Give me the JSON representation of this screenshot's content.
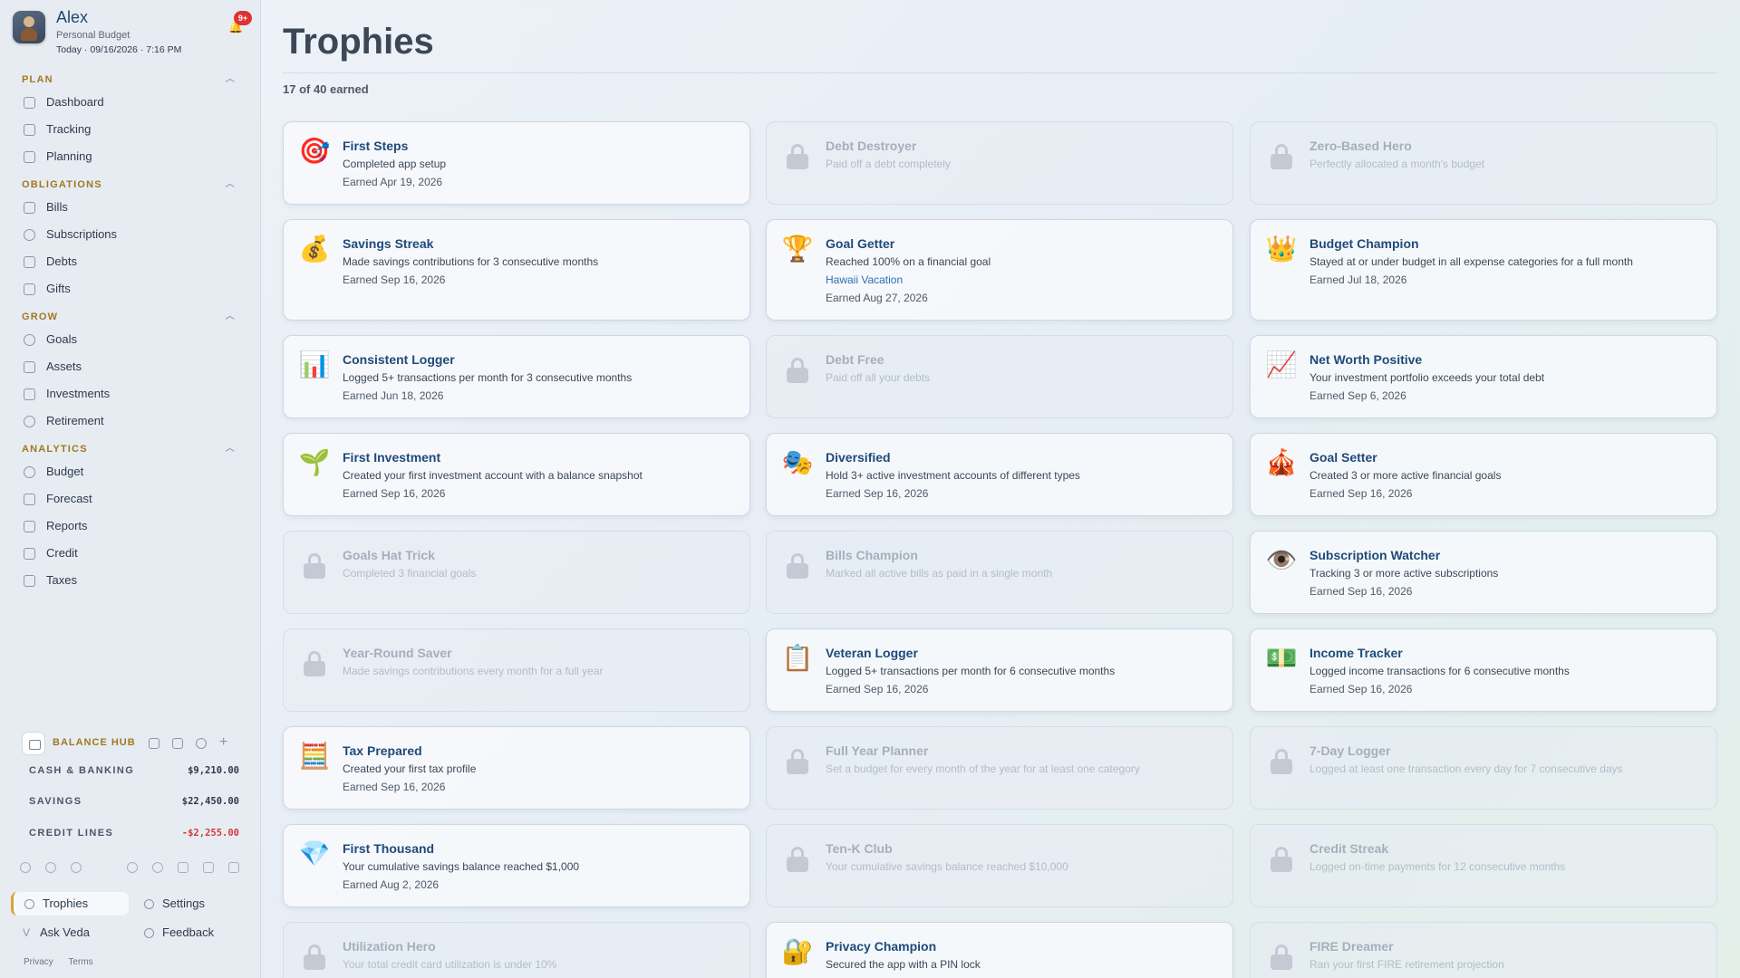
{
  "profile": {
    "name": "Alex",
    "subtitle": "Personal Budget",
    "date": "Today · 09/16/2026 · 7:16 PM",
    "notifications": "9+"
  },
  "sidebar": {
    "sections": [
      {
        "label": "PLAN",
        "items": [
          "Dashboard",
          "Tracking",
          "Planning"
        ]
      },
      {
        "label": "OBLIGATIONS",
        "items": [
          "Bills",
          "Subscriptions",
          "Debts",
          "Gifts"
        ]
      },
      {
        "label": "GROW",
        "items": [
          "Goals",
          "Assets",
          "Investments",
          "Retirement"
        ]
      },
      {
        "label": "ANALYTICS",
        "items": [
          "Budget",
          "Forecast",
          "Reports",
          "Credit",
          "Taxes"
        ]
      }
    ]
  },
  "balance_hub": {
    "title": "BALANCE HUB",
    "rows": [
      {
        "label": "CASH & BANKING",
        "value": "$9,210.00"
      },
      {
        "label": "SAVINGS",
        "value": "$22,450.00"
      },
      {
        "label": "CREDIT LINES",
        "value": "-$2,255.00"
      }
    ]
  },
  "bottom_nav": {
    "trophies": "Trophies",
    "settings": "Settings",
    "ask_veda": "Ask Veda",
    "feedback": "Feedback"
  },
  "footer": {
    "privacy": "Privacy",
    "terms": "Terms"
  },
  "page": {
    "title": "Trophies",
    "earned_count": "17 of 40 earned"
  },
  "colors": {
    "accent_gold": "#a1781f",
    "title_blue": "#1f4a7a",
    "negative_red": "#d23b3b",
    "link_blue": "#2b6fb8"
  },
  "trophies": [
    {
      "name": "First Steps",
      "desc": "Completed app setup",
      "date": "Earned Apr 19, 2026",
      "icon": "🎯",
      "icon_name": "target-icon",
      "locked": false
    },
    {
      "name": "Debt Destroyer",
      "desc": "Paid off a debt completely",
      "date": "",
      "icon": "",
      "icon_name": "lock-icon",
      "locked": true
    },
    {
      "name": "Zero-Based Hero",
      "desc": "Perfectly allocated a month's budget",
      "date": "",
      "icon": "",
      "icon_name": "lock-icon",
      "locked": true
    },
    {
      "name": "Savings Streak",
      "desc": "Made savings contributions for 3 consecutive months",
      "date": "Earned Sep 16, 2026",
      "icon": "💰",
      "icon_name": "money-bag-icon",
      "locked": false
    },
    {
      "name": "Goal Getter",
      "desc": "Reached 100% on a financial goal",
      "link": "Hawaii Vacation",
      "date": "Earned Aug 27, 2026",
      "icon": "🏆",
      "icon_name": "trophy-icon",
      "locked": false
    },
    {
      "name": "Budget Champion",
      "desc": "Stayed at or under budget in all expense categories for a full month",
      "date": "Earned Jul 18, 2026",
      "icon": "👑",
      "icon_name": "crown-icon",
      "locked": false
    },
    {
      "name": "Consistent Logger",
      "desc": "Logged 5+ transactions per month for 3 consecutive months",
      "date": "Earned Jun 18, 2026",
      "icon": "📊",
      "icon_name": "bar-chart-icon",
      "locked": false
    },
    {
      "name": "Debt Free",
      "desc": "Paid off all your debts",
      "date": "",
      "icon": "",
      "icon_name": "lock-icon",
      "locked": true
    },
    {
      "name": "Net Worth Positive",
      "desc": "Your investment portfolio exceeds your total debt",
      "date": "Earned Sep 6, 2026",
      "icon": "📈",
      "icon_name": "trending-up-icon",
      "locked": false
    },
    {
      "name": "First Investment",
      "desc": "Created your first investment account with a balance snapshot",
      "date": "Earned Sep 16, 2026",
      "icon": "🌱",
      "icon_name": "seedling-icon",
      "locked": false
    },
    {
      "name": "Diversified",
      "desc": "Hold 3+ active investment accounts of different types",
      "date": "Earned Sep 16, 2026",
      "icon": "🎭",
      "icon_name": "masks-icon",
      "locked": false
    },
    {
      "name": "Goal Setter",
      "desc": "Created 3 or more active financial goals",
      "date": "Earned Sep 16, 2026",
      "icon": "🎪",
      "icon_name": "circus-tent-icon",
      "locked": false
    },
    {
      "name": "Goals Hat Trick",
      "desc": "Completed 3 financial goals",
      "date": "",
      "icon": "",
      "icon_name": "lock-icon",
      "locked": true
    },
    {
      "name": "Bills Champion",
      "desc": "Marked all active bills as paid in a single month",
      "date": "",
      "icon": "",
      "icon_name": "lock-icon",
      "locked": true
    },
    {
      "name": "Subscription Watcher",
      "desc": "Tracking 3 or more active subscriptions",
      "date": "Earned Sep 16, 2026",
      "icon": "👁️",
      "icon_name": "eye-icon",
      "locked": false
    },
    {
      "name": "Year-Round Saver",
      "desc": "Made savings contributions every month for a full year",
      "date": "",
      "icon": "",
      "icon_name": "lock-icon",
      "locked": true
    },
    {
      "name": "Veteran Logger",
      "desc": "Logged 5+ transactions per month for 6 consecutive months",
      "date": "Earned Sep 16, 2026",
      "icon": "📋",
      "icon_name": "clipboard-icon",
      "locked": false
    },
    {
      "name": "Income Tracker",
      "desc": "Logged income transactions for 6 consecutive months",
      "date": "Earned Sep 16, 2026",
      "icon": "💵",
      "icon_name": "dollar-bill-icon",
      "locked": false
    },
    {
      "name": "Tax Prepared",
      "desc": "Created your first tax profile",
      "date": "Earned Sep 16, 2026",
      "icon": "🧮",
      "icon_name": "abacus-icon",
      "locked": false
    },
    {
      "name": "Full Year Planner",
      "desc": "Set a budget for every month of the year for at least one category",
      "date": "",
      "icon": "",
      "icon_name": "lock-icon",
      "locked": true
    },
    {
      "name": "7-Day Logger",
      "desc": "Logged at least one transaction every day for 7 consecutive days",
      "date": "",
      "icon": "",
      "icon_name": "lock-icon",
      "locked": true
    },
    {
      "name": "First Thousand",
      "desc": "Your cumulative savings balance reached $1,000",
      "date": "Earned Aug 2, 2026",
      "icon": "💎",
      "icon_name": "gem-icon",
      "locked": false
    },
    {
      "name": "Ten-K Club",
      "desc": "Your cumulative savings balance reached $10,000",
      "date": "",
      "icon": "",
      "icon_name": "lock-icon",
      "locked": true
    },
    {
      "name": "Credit Streak",
      "desc": "Logged on-time payments for 12 consecutive months",
      "date": "",
      "icon": "",
      "icon_name": "lock-icon",
      "locked": true
    },
    {
      "name": "Utilization Hero",
      "desc": "Your total credit card utilization is under 10%",
      "date": "",
      "icon": "",
      "icon_name": "lock-icon",
      "locked": true
    },
    {
      "name": "Privacy Champion",
      "desc": "Secured the app with a PIN lock",
      "date": "",
      "icon": "🔐",
      "icon_name": "locked-with-key-icon",
      "locked": false
    },
    {
      "name": "FIRE Dreamer",
      "desc": "Ran your first FIRE retirement projection",
      "date": "",
      "icon": "",
      "icon_name": "lock-icon",
      "locked": true
    }
  ]
}
